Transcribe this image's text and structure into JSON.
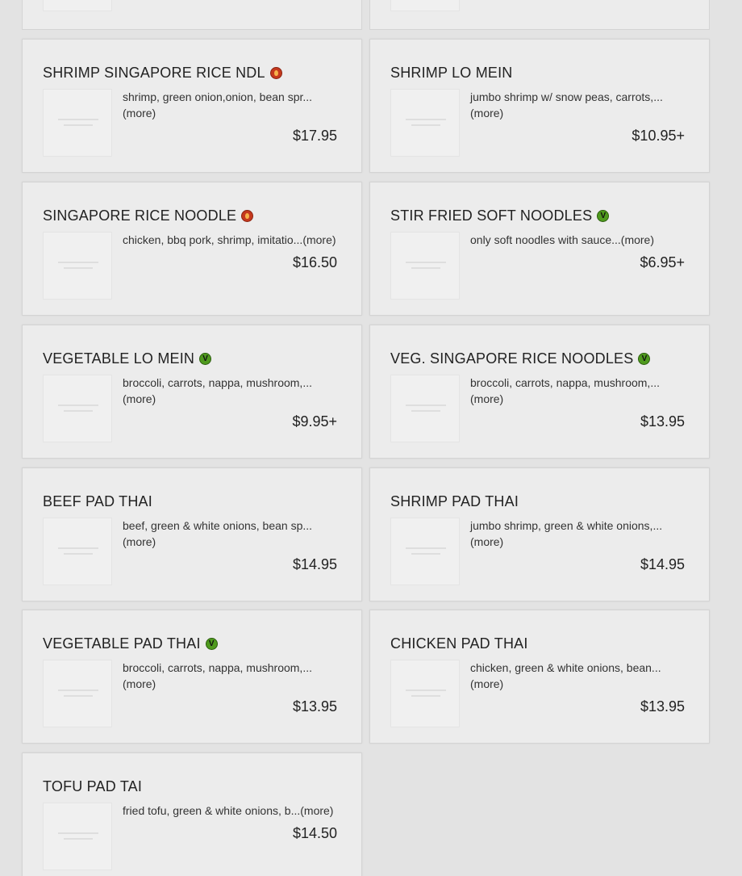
{
  "menu_items": [
    {
      "name": "SHRIMP SINGAPORE RICE NDL",
      "badge": "spicy",
      "description": "shrimp, green onion,onion, bean spr...",
      "more": "(more)",
      "price": "$17.95"
    },
    {
      "name": "SHRIMP LO MEIN",
      "badge": "",
      "description": "jumbo shrimp w/ snow peas, carrots,...",
      "more": "(more)",
      "price": "$10.95+"
    },
    {
      "name": "SINGAPORE RICE NOODLE",
      "badge": "spicy",
      "description": "chicken, bbq pork, shrimp, imitatio...",
      "more": "(more)",
      "price": "$16.50"
    },
    {
      "name": "STIR FRIED SOFT NOODLES",
      "badge": "vegan",
      "description": "only soft noodles with sauce...",
      "more": "(more)",
      "price": "$6.95+"
    },
    {
      "name": "VEGETABLE LO MEIN",
      "badge": "vegan",
      "description": "broccoli, carrots, nappa, mushroom,...",
      "more": "(more)",
      "price": "$9.95+"
    },
    {
      "name": "VEG. SINGAPORE RICE NOODLES",
      "badge": "vegan",
      "description": "broccoli, carrots, nappa, mushroom,...",
      "more": "(more)",
      "price": "$13.95"
    },
    {
      "name": "BEEF PAD THAI",
      "badge": "",
      "description": "beef, green & white onions, bean sp...",
      "more": "(more)",
      "price": "$14.95"
    },
    {
      "name": "SHRIMP PAD THAI",
      "badge": "",
      "description": "jumbo shrimp, green & white onions,...",
      "more": "(more)",
      "price": "$14.95"
    },
    {
      "name": "VEGETABLE PAD THAI",
      "badge": "vegan",
      "description": "broccoli, carrots, nappa, mushroom,...",
      "more": "(more)",
      "price": "$13.95"
    },
    {
      "name": "CHICKEN PAD THAI",
      "badge": "",
      "description": "chicken, green & white onions, bean...",
      "more": "(more)",
      "price": "$13.95"
    },
    {
      "name": "TOFU PAD TAI",
      "badge": "",
      "description": "fried tofu, green & white onions, b...",
      "more": "(more)",
      "price": "$14.50"
    }
  ],
  "badges": {
    "vegan_letter": "V"
  },
  "colors": {
    "background": "#e3e3e3",
    "card": "#ececec",
    "spicy": "#c5391d",
    "vegan": "#4f9a1e"
  }
}
